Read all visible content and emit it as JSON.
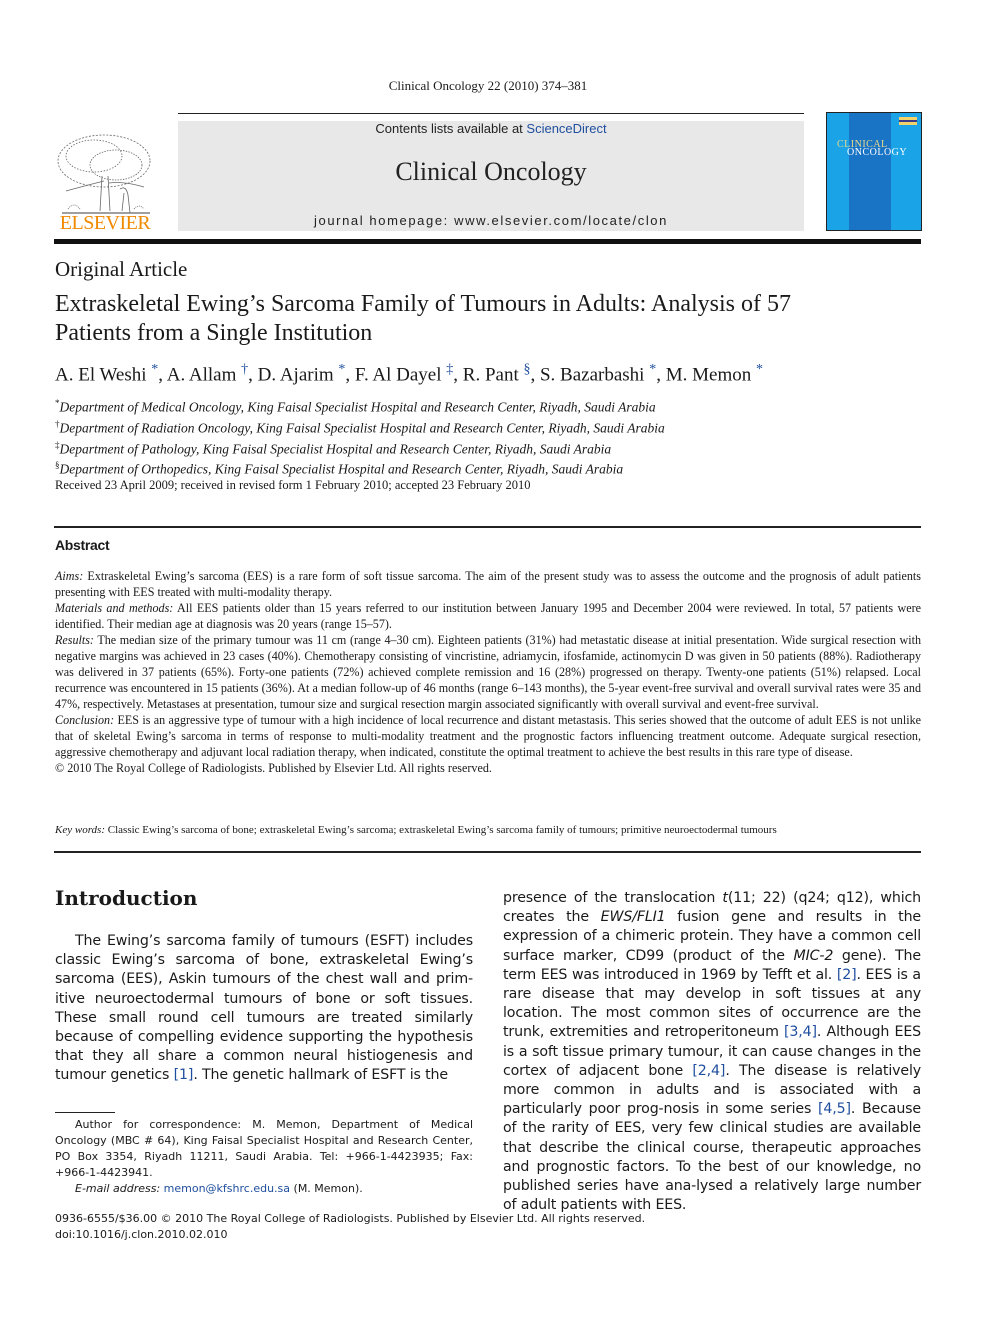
{
  "running_head": "Clinical Oncology 22 (2010) 374–381",
  "masthead": {
    "contents_prefix": "Contents lists available at ",
    "contents_link": "ScienceDirect",
    "journal_title": "Clinical Oncology",
    "homepage": "journal homepage: www.elsevier.com/locate/clon",
    "publisher_logo_text": "ELSEVIER",
    "cover_title_line1": "CLINICAL",
    "cover_title_line2": "ONCOLOGY"
  },
  "colors": {
    "link": "#1f4e9e",
    "elsevier_orange": "#f08a00",
    "cover_blue": "#1aa3e6",
    "masthead_gray": "#e8e8e8"
  },
  "article": {
    "type": "Original Article",
    "title": "Extraskeletal Ewing’s Sarcoma Family of Tumours in Adults: Analysis of 57 Patients from a Single Institution",
    "authors": [
      {
        "name": "A. El Weshi",
        "mark": "*"
      },
      {
        "name": "A. Allam",
        "mark": "†"
      },
      {
        "name": "D. Ajarim",
        "mark": "*"
      },
      {
        "name": "F. Al Dayel",
        "mark": "‡"
      },
      {
        "name": "R. Pant",
        "mark": "§"
      },
      {
        "name": "S. Bazarbashi",
        "mark": "*"
      },
      {
        "name": "M. Memon",
        "mark": "*"
      }
    ],
    "affiliations": [
      {
        "mark": "*",
        "text": "Department of Medical Oncology, King Faisal Specialist Hospital and Research Center, Riyadh, Saudi Arabia"
      },
      {
        "mark": "†",
        "text": "Department of Radiation Oncology, King Faisal Specialist Hospital and Research Center, Riyadh, Saudi Arabia"
      },
      {
        "mark": "‡",
        "text": "Department of Pathology, King Faisal Specialist Hospital and Research Center, Riyadh, Saudi Arabia"
      },
      {
        "mark": "§",
        "text": "Department of Orthopedics, King Faisal Specialist Hospital and Research Center, Riyadh, Saudi Arabia"
      }
    ],
    "dates": "Received 23 April 2009; received in revised form 1 February 2010; accepted 23 February 2010"
  },
  "abstract": {
    "heading": "Abstract",
    "sections": [
      {
        "label": "Aims:",
        "text": " Extraskeletal Ewing’s sarcoma (EES) is a rare form of soft tissue sarcoma. The aim of the present study was to assess the outcome and the prognosis of adult patients presenting with EES treated with multi-modality therapy."
      },
      {
        "label": "Materials and methods:",
        "text": " All EES patients older than 15 years referred to our institution between January 1995 and December 2004 were reviewed. In total, 57 patients were identified. Their median age at diagnosis was 20 years (range 15–57)."
      },
      {
        "label": "Results:",
        "text": " The median size of the primary tumour was 11 cm (range 4–30 cm). Eighteen patients (31%) had metastatic disease at initial presentation. Wide surgical resection with negative margins was achieved in 23 cases (40%). Chemotherapy consisting of vincristine, adriamycin, ifosfamide, actinomycin D was given in 50 patients (88%). Radiotherapy was delivered in 37 patients (65%). Forty-one patients (72%) achieved complete remission and 16 (28%) progressed on therapy. Twenty-one patients (51%) relapsed. Local recurrence was encountered in 15 patients (36%). At a median follow-up of 46 months (range 6–143 months), the 5-year event-free survival and overall survival rates were 35 and 47%, respectively. Metastases at presentation, tumour size and surgical resection margin associated significantly with overall survival and event-free survival."
      },
      {
        "label": "Conclusion:",
        "text": " EES is an aggressive type of tumour with a high incidence of local recurrence and distant metastasis. This series showed that the outcome of adult EES is not unlike that of skeletal Ewing’s sarcoma in terms of response to multi-modality treatment and the prognostic factors influencing treatment outcome. Adequate surgical resection, aggressive chemotherapy and adjuvant local radiation therapy, when indicated, constitute the optimal treatment to achieve the best results in this rare type of disease."
      }
    ],
    "copyright": "© 2010 The Royal College of Radiologists. Published by Elsevier Ltd. All rights reserved.",
    "keywords_label": "Key words:",
    "keywords": " Classic Ewing’s sarcoma of bone; extraskeletal Ewing’s sarcoma; extraskeletal Ewing’s sarcoma family of tumours; primitive neuroectodermal tumours"
  },
  "introduction": {
    "heading": "Introduction",
    "left": {
      "t1": "The Ewing’s sarcoma family of tumours (ESFT) includes classic Ewing’s sarcoma of bone, extraskeletal Ewing’s sarcoma (EES), Askin tumours of the chest wall and prim-itive neuroectodermal tumours of bone or soft tissues. These small round cell tumours are treated similarly because of compelling evidence supporting the hypothesis that they all share a common neural histiogenesis and tumour genetics ",
      "ref1": "[1]",
      "t2": ". The genetic hallmark of ESFT is the"
    },
    "right": {
      "t1": "presence of the translocation ",
      "i1": "t",
      "t2": "(11; 22) (q24; q12), which creates the ",
      "i2": "EWS/FLI1",
      "t3": " fusion gene and results in the expression of a chimeric protein. They have a common cell surface marker, CD99 (product of the ",
      "i3": "MIC-2",
      "t4": " gene). The term EES was introduced in 1969 by Tefft et al. ",
      "ref2": "[2]",
      "t5": ". EES is a rare disease that may develop in soft tissues at any location. The most common sites of occurrence are the trunk, extremities and retroperitoneum ",
      "ref3": "[3,4]",
      "t6": ". Although EES is a soft tissue primary tumour, it can cause changes in the cortex of adjacent bone ",
      "ref4": "[2,4]",
      "t7": ". The disease is relatively more common in adults and is associated with a particularly poor prog-nosis in some series ",
      "ref5": "[4,5]",
      "t8": ". Because of the rarity of EES, very few clinical studies are available that describe the clinical course, therapeutic approaches and prognostic factors. To the best of our knowledge, no published series have ana-lysed a relatively large number of adult patients with EES."
    }
  },
  "footnote": {
    "correspondence": "Author for correspondence: M. Memon, Department of Medical Oncology (MBC # 64), King Faisal Specialist Hospital and Research Center, PO Box 3354, Riyadh 11211, Saudi Arabia. Tel: +966-1-4423935; Fax: +966-1-4423941.",
    "email_label": "E-mail address:",
    "email": "memon@kfshrc.edu.sa",
    "email_suffix": " (M. Memon)."
  },
  "footer": {
    "issn_line": "0936-6555/$36.00 © 2010 The Royal College of Radiologists. Published by Elsevier Ltd. All rights reserved.",
    "doi": "doi:10.1016/j.clon.2010.02.010"
  }
}
